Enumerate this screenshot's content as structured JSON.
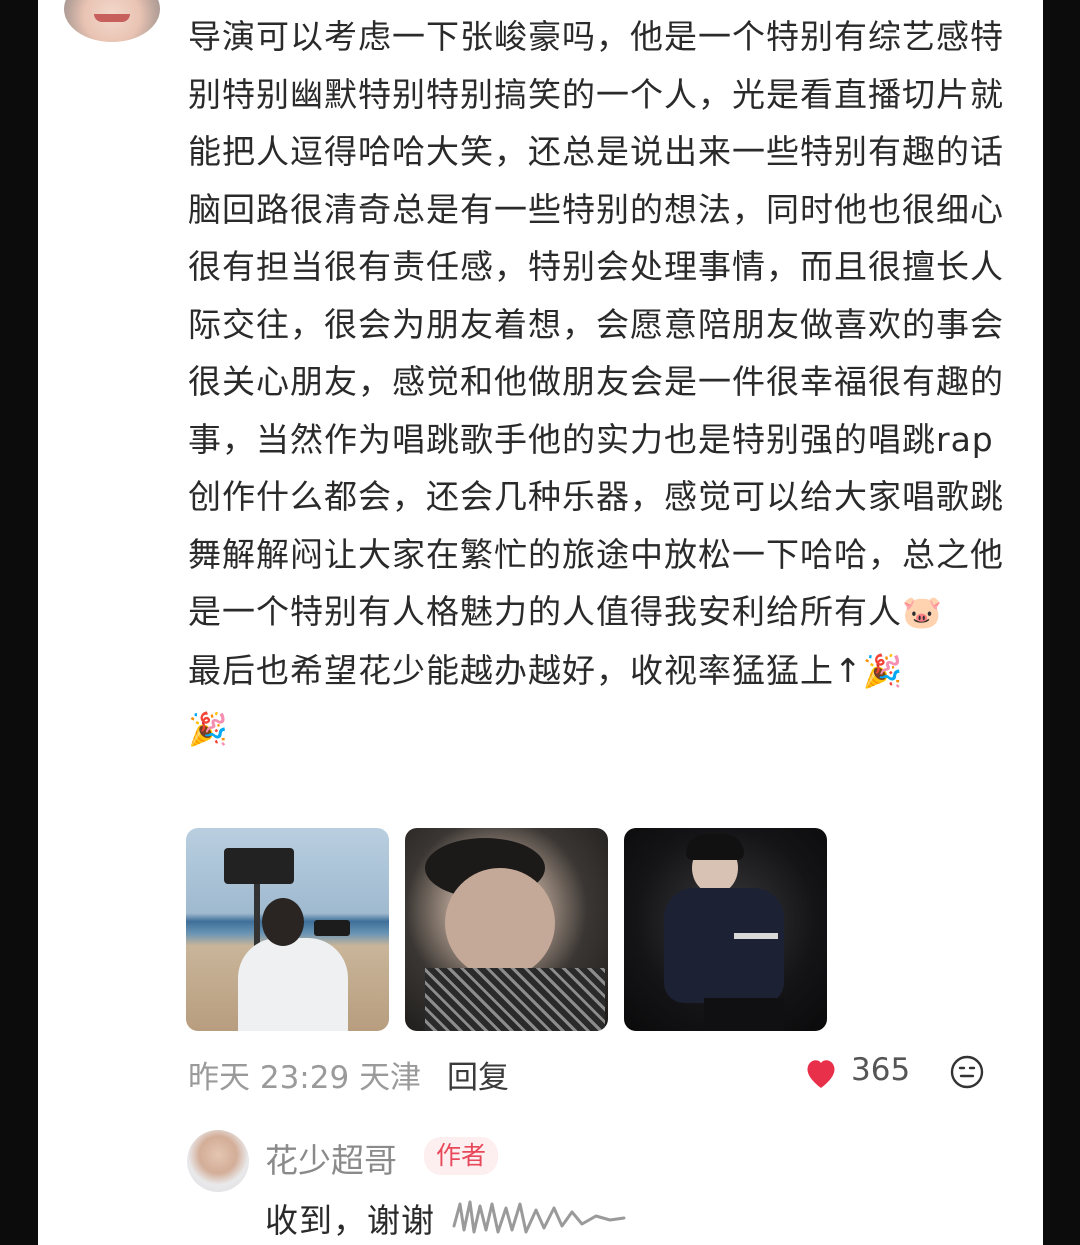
{
  "comment": {
    "body": "导演可以考虑一下张峻豪吗，他是一个特别有综艺感特别特别幽默特别特别搞笑的一个人，光是看直播切片就能把人逗得哈哈大笑，还总是说出来一些特别有趣的话脑回路很清奇总是有一些特别的想法，同时他也很细心很有担当很有责任感，特别会处理事情，而且很擅长人际交往，很会为朋友着想，会愿意陪朋友做喜欢的事会很关心朋友，感觉和他做朋友会是一件很幸福很有趣的事，当然作为唱跳歌手他的实力也是特别强的唱跳rap创作什么都会，还会几种乐器，感觉可以给大家唱歌跳舞解解闷让大家在繁忙的旅途中放松一下哈哈，总之他是一个特别有人格魅力的人值得我安利给所有人",
    "emoji_1": "🐷",
    "line_end": "最后也希望花少能越办越好，收视率猛猛上↑",
    "emoji_2": "🎉",
    "emoji_3": "🎉",
    "time": "昨天 23:29",
    "location": "天津",
    "reply_label": "回复",
    "like_count": "365",
    "like_color": "#e8304a"
  },
  "reply": {
    "author": "花少超哥",
    "badge": "作者",
    "text": "收到，谢谢"
  },
  "icons": {
    "like": "heart-icon",
    "react": "smile-emoji-icon"
  }
}
